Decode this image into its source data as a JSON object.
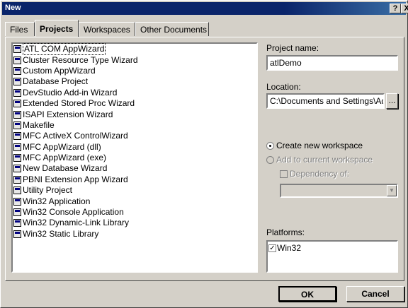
{
  "window": {
    "title": "New",
    "help_btn": "?",
    "close_btn": "X"
  },
  "tabs": [
    {
      "label": "Files"
    },
    {
      "label": "Projects"
    },
    {
      "label": "Workspaces"
    },
    {
      "label": "Other Documents"
    }
  ],
  "active_tab": "Projects",
  "project_types": [
    "ATL COM AppWizard",
    "Cluster Resource Type Wizard",
    "Custom AppWizard",
    "Database Project",
    "DevStudio Add-in Wizard",
    "Extended Stored Proc Wizard",
    "ISAPI Extension Wizard",
    "Makefile",
    "MFC ActiveX ControlWizard",
    "MFC AppWizard (dll)",
    "MFC AppWizard (exe)",
    "New Database Wizard",
    "PBNI Extension App Wizard",
    "Utility Project",
    "Win32 Application",
    "Win32 Console Application",
    "Win32 Dynamic-Link Library",
    "Win32 Static Library"
  ],
  "selected_project_type": "ATL COM AppWizard",
  "project_name": {
    "label": "Project name:",
    "value": "atlDemo"
  },
  "location": {
    "label": "Location:",
    "value": "C:\\Documents and Settings\\Adm",
    "browse": "..."
  },
  "workspace": {
    "create_new": "Create new workspace",
    "add_to_current": "Add to current workspace",
    "dependency_of": "Dependency of:",
    "selected": "create_new"
  },
  "platforms": {
    "label": "Platforms:",
    "items": [
      {
        "name": "Win32",
        "checked": true
      }
    ]
  },
  "buttons": {
    "ok": "OK",
    "cancel": "Cancel"
  }
}
